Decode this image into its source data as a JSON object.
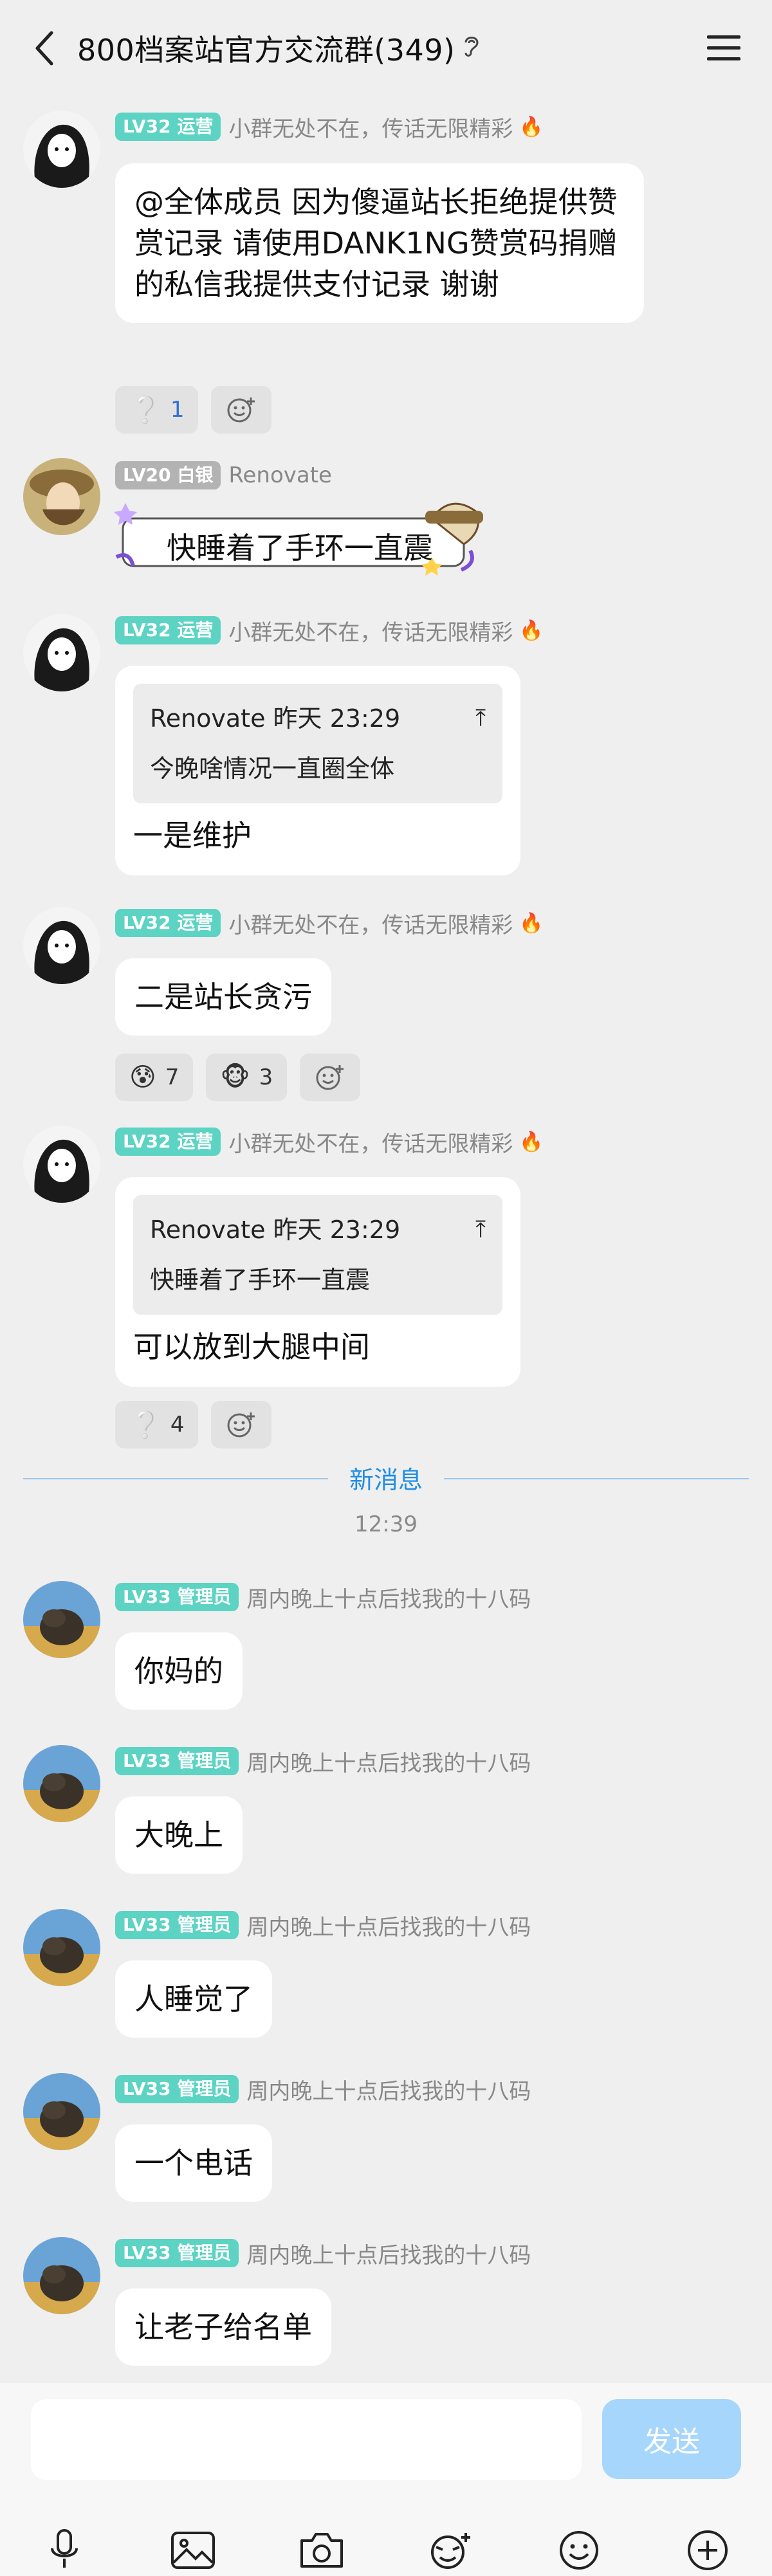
{
  "header": {
    "title": "800档案站官方交流群(349)"
  },
  "messages": [
    {
      "level": "LV32 运营",
      "name": "小群无处不在，传话无限精彩",
      "text": "@全体成员 因为傻逼站长拒绝提供赞赏记录 请使用DANK1NG赞赏码捐赠的私信我提供支付记录 谢谢",
      "reactions": [
        {
          "emoji": "❔",
          "count": "1"
        },
        {
          "emoji": "add-reaction-icon",
          "count": ""
        }
      ]
    },
    {
      "level": "LV20 白银",
      "name": "Renovate",
      "text": "快睡着了手环一直震"
    },
    {
      "level": "LV32 运营",
      "name": "小群无处不在，传话无限精彩",
      "quote_author": "Renovate  昨天 23:29",
      "quote_text": "今晚啥情况一直圈全体",
      "text": "一是维护"
    },
    {
      "level": "LV32 运营",
      "name": "小群无处不在，传话无限精彩",
      "text": "二是站长贪污",
      "reactions": [
        {
          "emoji": "😰",
          "count": "7"
        },
        {
          "emoji": "🐵",
          "count": "3"
        },
        {
          "emoji": "add-reaction-icon",
          "count": ""
        }
      ]
    },
    {
      "level": "LV32 运营",
      "name": "小群无处不在，传话无限精彩",
      "quote_author": "Renovate  昨天 23:29",
      "quote_text": "快睡着了手环一直震",
      "text": "可以放到大腿中间",
      "reactions": [
        {
          "emoji": "❔",
          "count": "4"
        },
        {
          "emoji": "add-reaction-icon",
          "count": ""
        }
      ]
    }
  ],
  "divider": {
    "label": "新消息",
    "time": "12:39"
  },
  "admin_messages": [
    {
      "level": "LV33 管理员",
      "name": "周内晚上十点后找我的十八码",
      "text": "你妈的"
    },
    {
      "level": "LV33 管理员",
      "name": "周内晚上十点后找我的十八码",
      "text": "大晚上"
    },
    {
      "level": "LV33 管理员",
      "name": "周内晚上十点后找我的十八码",
      "text": "人睡觉了"
    },
    {
      "level": "LV33 管理员",
      "name": "周内晚上十点后找我的十八码",
      "text": "一个电话"
    },
    {
      "level": "LV33 管理员",
      "name": "周内晚上十点后找我的十八码",
      "text": "让老子给名单"
    }
  ],
  "input": {
    "placeholder": "",
    "send_label": "发送"
  },
  "colors": {
    "level_green": "#5dd3c3",
    "level_gray": "#b3b3b3",
    "accent_blue": "#1f8de6",
    "send_disabled": "#a6d6fb"
  }
}
